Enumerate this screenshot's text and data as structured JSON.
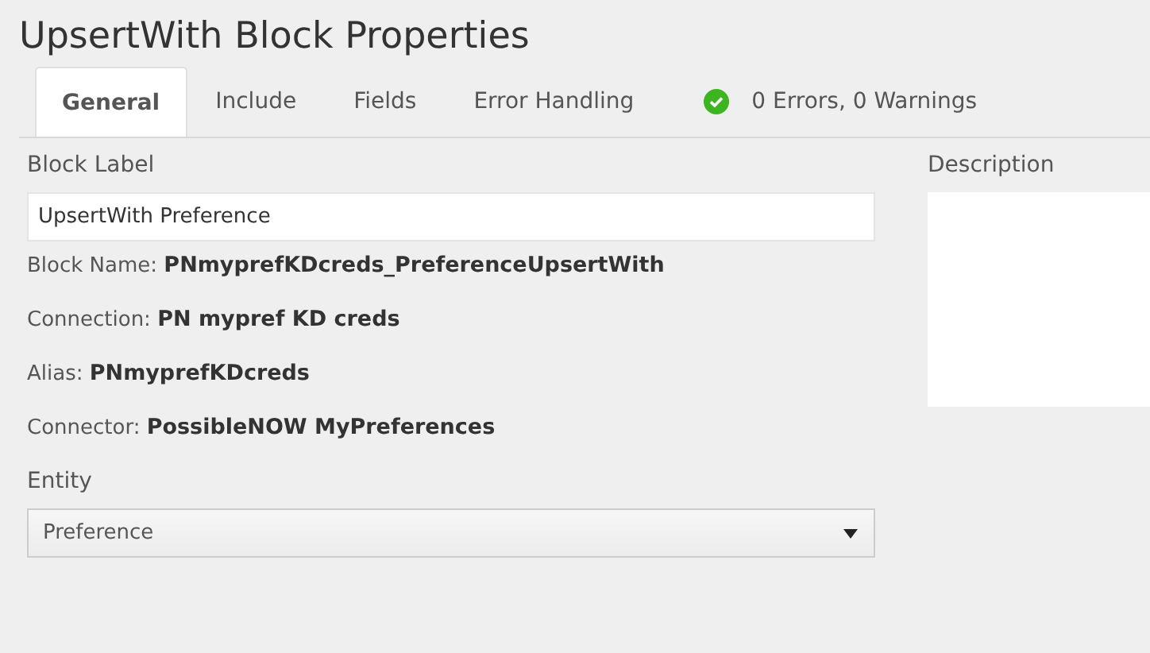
{
  "title": "UpsertWith Block Properties",
  "tabs": [
    {
      "label": "General",
      "selected": true
    },
    {
      "label": "Include",
      "selected": false
    },
    {
      "label": "Fields",
      "selected": false
    },
    {
      "label": "Error Handling",
      "selected": false
    }
  ],
  "status": {
    "kind": "ok",
    "text": "0 Errors, 0 Warnings"
  },
  "block_label": {
    "label": "Block Label",
    "value": "UpsertWith Preference"
  },
  "details": [
    {
      "label": "Block Name:",
      "value": "PNmyprefKDcreds_PreferenceUpsertWith"
    },
    {
      "label": "Connection:",
      "value": "PN mypref KD creds"
    },
    {
      "label": "Alias:",
      "value": "PNmyprefKDcreds"
    },
    {
      "label": "Connector:",
      "value": "PossibleNOW MyPreferences"
    }
  ],
  "entity": {
    "label": "Entity",
    "value": "Preference"
  },
  "description": {
    "label": "Description"
  }
}
